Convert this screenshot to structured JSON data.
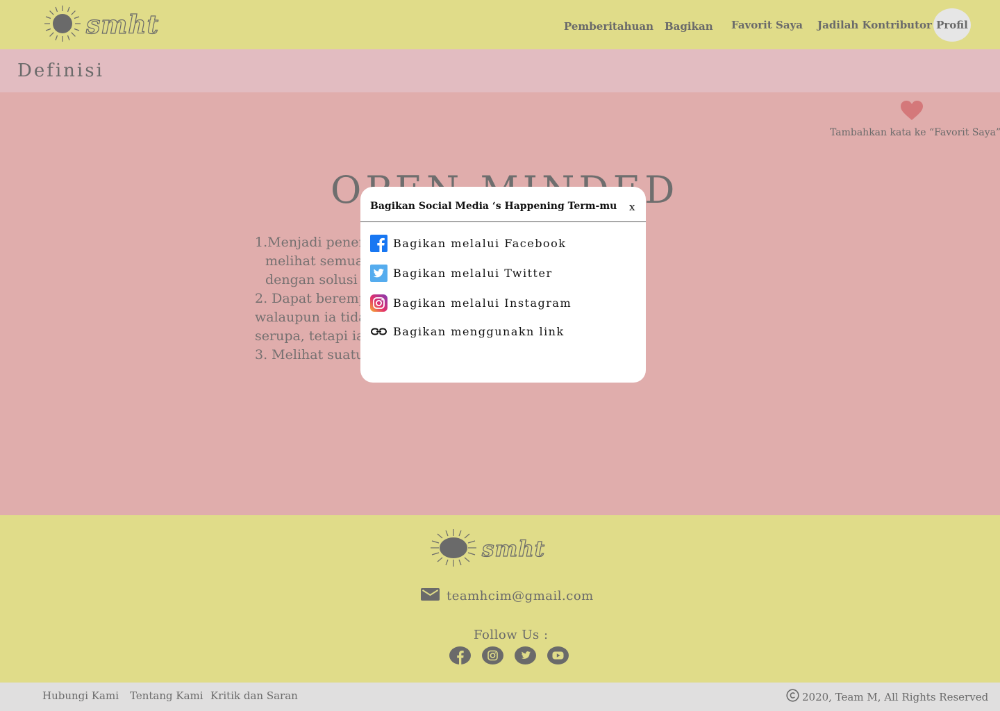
{
  "header": {
    "logo_text": "smht",
    "nav": [
      "Pemberitahuan",
      "Bagikan",
      "Favorit Saya",
      "Jadilah Kontributor"
    ],
    "profile_label": "Profil"
  },
  "subbar": {
    "title": "Definisi"
  },
  "favorite": {
    "label": "Tambahkan kata ke “Favorit Saya”"
  },
  "term": {
    "title": "OPEN-MINDED"
  },
  "definition": {
    "lines": [
      "1.Menjadi penerim                                                                si untuk",
      "melihat semua                                                                        h dan muncul",
      "dengan solusi y",
      "2. Dapat berempa                                                                    rang lain,",
      "walaupun ia tidal                                                                   lami kejadian",
      "serupa, tetapi ia t                                                                 adi dia...”",
      "3. Melihat suatu m"
    ]
  },
  "modal": {
    "title": "Bagikan Social Media ‘s Happening Term-mu",
    "close": "x",
    "options": [
      {
        "icon": "facebook-icon",
        "label": "Bagikan melalui Facebook"
      },
      {
        "icon": "twitter-icon",
        "label": "Bagikan melalui Twitter"
      },
      {
        "icon": "instagram-icon",
        "label": "Bagikan melalui Instagram"
      },
      {
        "icon": "link-icon",
        "label": "Bagikan menggunakn link"
      }
    ]
  },
  "footer": {
    "logo_text": "smht",
    "email": "teamhcim@gmail.com",
    "follow_label": "Follow Us :",
    "social_icons": [
      "facebook-icon",
      "instagram-icon",
      "twitter-icon",
      "youtube-icon"
    ]
  },
  "bottom": {
    "links": [
      "Hubungi Kami",
      "Tentang Kami",
      "Kritik dan Saran"
    ],
    "copyright": "2020, Team M, All Rights Reserved"
  },
  "colors": {
    "header_bg": "#e0dc89",
    "subbar_bg": "#e2bcc1",
    "page_bg": "#e0adac",
    "footer_bg": "#e0dc89",
    "bottom_bg": "#e0dfdf",
    "heart": "#d4787a",
    "text": "#6a6a6a"
  }
}
